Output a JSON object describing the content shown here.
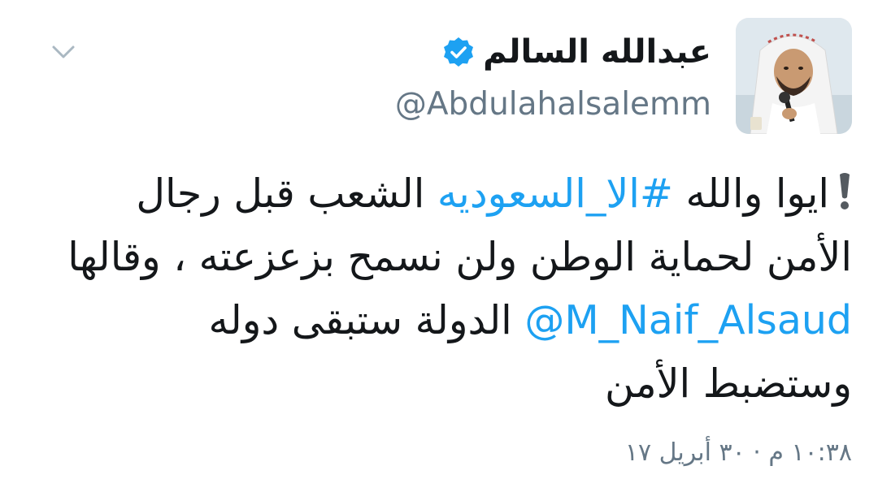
{
  "user": {
    "display_name": "عبدالله السالم",
    "handle": "@Abdulahalsalemm",
    "verified_icon": "verified-badge-icon",
    "avatar_icon": "avatar-photo"
  },
  "menu": {
    "icon": "chevron-down-icon"
  },
  "tweet": {
    "exclaim_icon": "heavy-exclamation-mark-emoji",
    "line1_pre": "ايوا والله ",
    "hashtag": "#الا_السعوديه",
    "line1_post": " الشعب قبل رجال",
    "line2": "الأمن لحماية الوطن ولن نسمح بزعزعته ، وقالها",
    "mention": "@M_Naif_Alsaud",
    "line3_post": " الدولة ستبقى دوله",
    "line4": "وستضبط الأمن"
  },
  "timestamp": "١٠:٣٨ م · ٣٠ أبريل ١٧",
  "colors": {
    "link": "#1da1f2",
    "secondary": "#657786",
    "text": "#14171a"
  }
}
